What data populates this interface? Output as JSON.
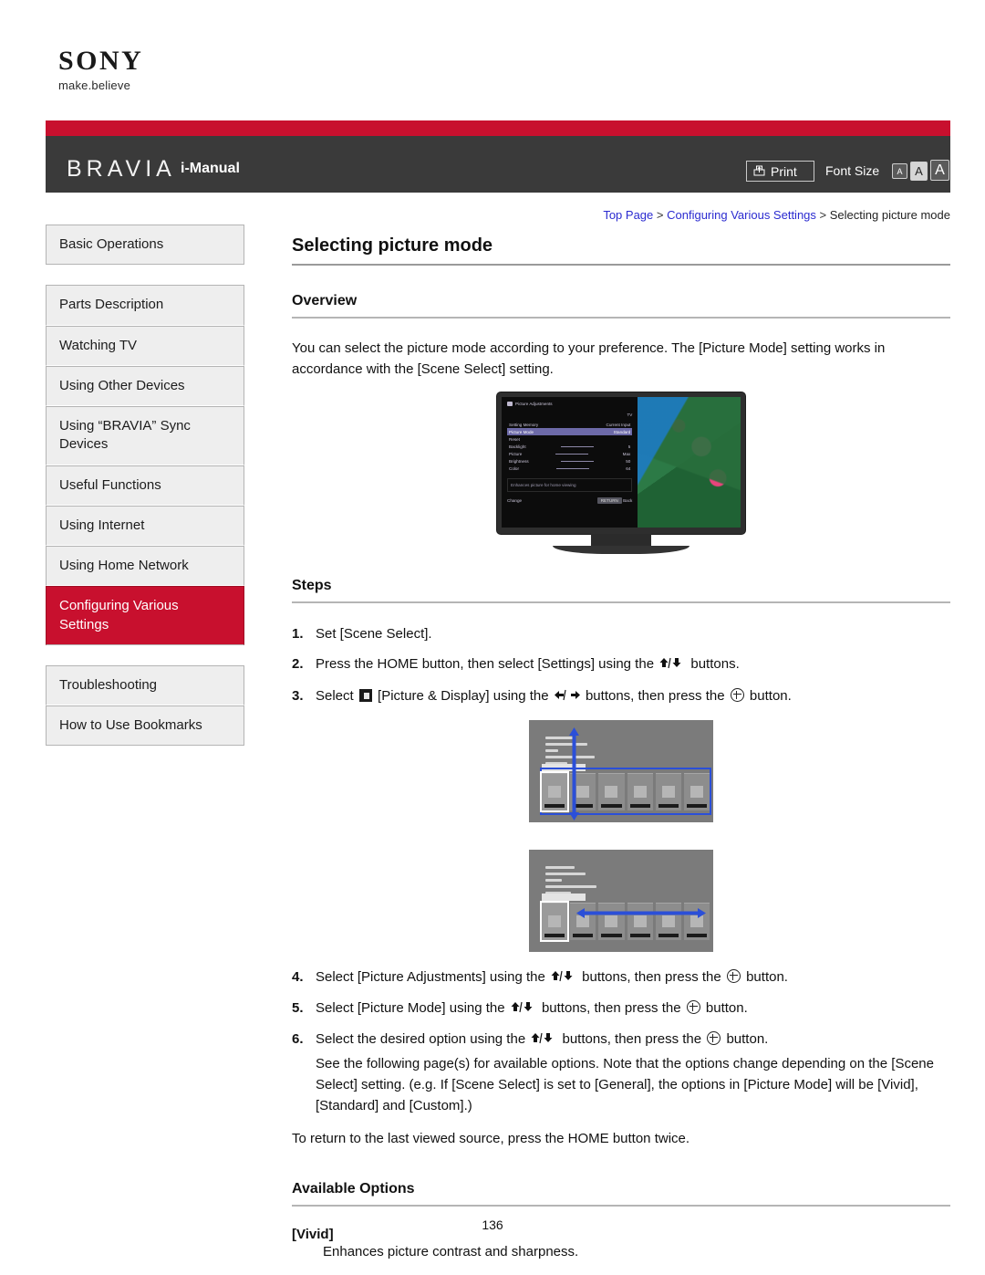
{
  "brand": {
    "logo_text": "SONY",
    "tagline": "make.believe"
  },
  "header": {
    "product": "BRAVIA",
    "manual_label": "i-Manual",
    "print_label": "Print",
    "font_size_label": "Font Size",
    "font_size_options": [
      "A",
      "A",
      "A"
    ],
    "bar_accent_color": "#c8102e",
    "bar_dark_color": "#3a3a3a"
  },
  "breadcrumb": {
    "items": [
      {
        "label": "Top Page",
        "link": true
      },
      {
        "label": "Configuring Various Settings",
        "link": true
      },
      {
        "label": "Selecting picture mode",
        "link": false
      }
    ],
    "separator": ">"
  },
  "sidebar": {
    "groups": [
      {
        "items": [
          {
            "label": "Basic Operations",
            "active": false
          }
        ]
      },
      {
        "items": [
          {
            "label": "Parts Description",
            "active": false
          },
          {
            "label": "Watching TV",
            "active": false
          },
          {
            "label": "Using Other Devices",
            "active": false
          },
          {
            "label": "Using “BRAVIA” Sync Devices",
            "active": false
          },
          {
            "label": "Useful Functions",
            "active": false
          },
          {
            "label": "Using Internet",
            "active": false
          },
          {
            "label": "Using Home Network",
            "active": false
          },
          {
            "label": "Configuring Various Settings",
            "active": true
          }
        ]
      },
      {
        "items": [
          {
            "label": "Troubleshooting",
            "active": false
          },
          {
            "label": "How to Use Bookmarks",
            "active": false
          }
        ]
      }
    ],
    "active_color": "#c8102e"
  },
  "main": {
    "page_title": "Selecting picture mode",
    "overview": {
      "heading": "Overview",
      "paragraph": "You can select the picture mode according to your preference. The [Picture Mode] setting works in accordance with the [Scene Select] setting."
    },
    "tv_image": {
      "menu_title": "Picture Adjustments",
      "corner_label": "TV",
      "col_left": "Setting Memory",
      "col_right": "Current Input",
      "rows": [
        {
          "name": "Picture Mode",
          "value": "Standard",
          "highlighted": true
        },
        {
          "name": "Reset",
          "value": ""
        },
        {
          "name": "Backlight",
          "value": "5"
        },
        {
          "name": "Picture",
          "value": "Max"
        },
        {
          "name": "Brightness",
          "value": "50"
        },
        {
          "name": "Color",
          "value": "64"
        }
      ],
      "note": "Enhances picture for home viewing",
      "foot_left": "Change",
      "foot_chip": "RETURN",
      "foot_right": "Back"
    },
    "steps": {
      "heading": "Steps",
      "items": [
        {
          "num": "1.",
          "text": "Set [Scene Select]."
        },
        {
          "num": "2.",
          "pre": "Press the HOME button, then select [Settings] using the ",
          "icon": "up-down-arrows",
          "post": " buttons."
        },
        {
          "num": "3.",
          "pre": "Select ",
          "icon_inline": "picture-display-icon",
          "mid": " [Picture & Display] using the ",
          "icon": "left-right-arrows",
          "post": " buttons, then press the ",
          "icon2": "enter-button",
          "tail": " button."
        },
        {
          "num": "4.",
          "pre": "Select [Picture Adjustments] using the ",
          "icon": "up-down-arrows",
          "post": " buttons, then press the ",
          "icon2": "enter-button",
          "tail": " button."
        },
        {
          "num": "5.",
          "pre": "Select [Picture Mode] using the ",
          "icon": "up-down-arrows",
          "post": " buttons, then press the ",
          "icon2": "enter-button",
          "tail": " button."
        },
        {
          "num": "6.",
          "pre": "Select the desired option using the ",
          "icon": "up-down-arrows",
          "post": " buttons, then press the ",
          "icon2": "enter-button",
          "tail": " button."
        }
      ],
      "step6_note": "See the following page(s) for available options. Note that the options change depending on the [Scene Select] setting. (e.g. If [Scene Select] is set to [General], the options in [Picture Mode] will be [Vivid], [Standard] and [Custom].)",
      "closing_note": "To return to the last viewed source, press the HOME button twice."
    },
    "available_options": {
      "heading": "Available Options",
      "options": [
        {
          "name": "[Vivid]",
          "desc": "Enhances picture contrast and sharpness."
        }
      ]
    }
  },
  "footer": {
    "page_number": "136"
  }
}
